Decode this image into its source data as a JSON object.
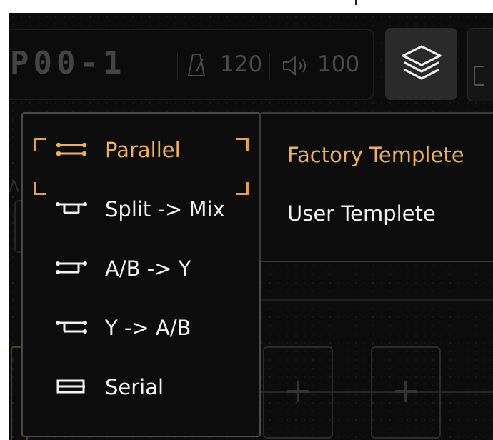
{
  "header": {
    "preset_name": "P00-1",
    "tempo": "120",
    "volume": "100"
  },
  "routing_menu": {
    "items": [
      {
        "label": "Parallel",
        "icon": "parallel-icon",
        "selected": true
      },
      {
        "label": "Split -> Mix",
        "icon": "split-mix-icon",
        "selected": false
      },
      {
        "label": "A/B -> Y",
        "icon": "ab-y-icon",
        "selected": false
      },
      {
        "label": "Y -> A/B",
        "icon": "y-ab-icon",
        "selected": false
      },
      {
        "label": "Serial",
        "icon": "serial-icon",
        "selected": false
      }
    ]
  },
  "template_menu": {
    "items": [
      {
        "label": "Factory Templete",
        "active": true
      },
      {
        "label": "User Templete",
        "active": false
      }
    ]
  },
  "colors": {
    "accent": "#f0b24e",
    "background": "#0c0c0c",
    "text": "#f2f2f2",
    "muted": "#4a4a4a"
  }
}
